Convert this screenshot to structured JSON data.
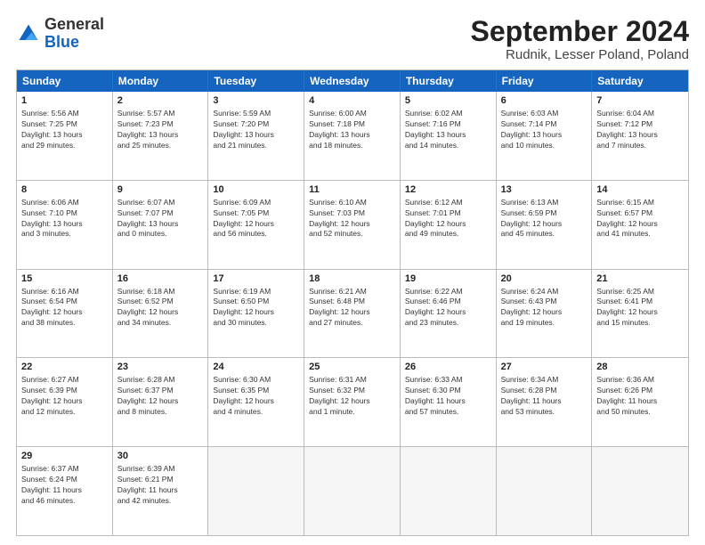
{
  "header": {
    "logo": {
      "general": "General",
      "blue": "Blue"
    },
    "month_title": "September 2024",
    "location": "Rudnik, Lesser Poland, Poland"
  },
  "weekdays": [
    "Sunday",
    "Monday",
    "Tuesday",
    "Wednesday",
    "Thursday",
    "Friday",
    "Saturday"
  ],
  "rows": [
    [
      {
        "day": "1",
        "info": "Sunrise: 5:56 AM\nSunset: 7:25 PM\nDaylight: 13 hours\nand 29 minutes."
      },
      {
        "day": "2",
        "info": "Sunrise: 5:57 AM\nSunset: 7:23 PM\nDaylight: 13 hours\nand 25 minutes."
      },
      {
        "day": "3",
        "info": "Sunrise: 5:59 AM\nSunset: 7:20 PM\nDaylight: 13 hours\nand 21 minutes."
      },
      {
        "day": "4",
        "info": "Sunrise: 6:00 AM\nSunset: 7:18 PM\nDaylight: 13 hours\nand 18 minutes."
      },
      {
        "day": "5",
        "info": "Sunrise: 6:02 AM\nSunset: 7:16 PM\nDaylight: 13 hours\nand 14 minutes."
      },
      {
        "day": "6",
        "info": "Sunrise: 6:03 AM\nSunset: 7:14 PM\nDaylight: 13 hours\nand 10 minutes."
      },
      {
        "day": "7",
        "info": "Sunrise: 6:04 AM\nSunset: 7:12 PM\nDaylight: 13 hours\nand 7 minutes."
      }
    ],
    [
      {
        "day": "8",
        "info": "Sunrise: 6:06 AM\nSunset: 7:10 PM\nDaylight: 13 hours\nand 3 minutes."
      },
      {
        "day": "9",
        "info": "Sunrise: 6:07 AM\nSunset: 7:07 PM\nDaylight: 13 hours\nand 0 minutes."
      },
      {
        "day": "10",
        "info": "Sunrise: 6:09 AM\nSunset: 7:05 PM\nDaylight: 12 hours\nand 56 minutes."
      },
      {
        "day": "11",
        "info": "Sunrise: 6:10 AM\nSunset: 7:03 PM\nDaylight: 12 hours\nand 52 minutes."
      },
      {
        "day": "12",
        "info": "Sunrise: 6:12 AM\nSunset: 7:01 PM\nDaylight: 12 hours\nand 49 minutes."
      },
      {
        "day": "13",
        "info": "Sunrise: 6:13 AM\nSunset: 6:59 PM\nDaylight: 12 hours\nand 45 minutes."
      },
      {
        "day": "14",
        "info": "Sunrise: 6:15 AM\nSunset: 6:57 PM\nDaylight: 12 hours\nand 41 minutes."
      }
    ],
    [
      {
        "day": "15",
        "info": "Sunrise: 6:16 AM\nSunset: 6:54 PM\nDaylight: 12 hours\nand 38 minutes."
      },
      {
        "day": "16",
        "info": "Sunrise: 6:18 AM\nSunset: 6:52 PM\nDaylight: 12 hours\nand 34 minutes."
      },
      {
        "day": "17",
        "info": "Sunrise: 6:19 AM\nSunset: 6:50 PM\nDaylight: 12 hours\nand 30 minutes."
      },
      {
        "day": "18",
        "info": "Sunrise: 6:21 AM\nSunset: 6:48 PM\nDaylight: 12 hours\nand 27 minutes."
      },
      {
        "day": "19",
        "info": "Sunrise: 6:22 AM\nSunset: 6:46 PM\nDaylight: 12 hours\nand 23 minutes."
      },
      {
        "day": "20",
        "info": "Sunrise: 6:24 AM\nSunset: 6:43 PM\nDaylight: 12 hours\nand 19 minutes."
      },
      {
        "day": "21",
        "info": "Sunrise: 6:25 AM\nSunset: 6:41 PM\nDaylight: 12 hours\nand 15 minutes."
      }
    ],
    [
      {
        "day": "22",
        "info": "Sunrise: 6:27 AM\nSunset: 6:39 PM\nDaylight: 12 hours\nand 12 minutes."
      },
      {
        "day": "23",
        "info": "Sunrise: 6:28 AM\nSunset: 6:37 PM\nDaylight: 12 hours\nand 8 minutes."
      },
      {
        "day": "24",
        "info": "Sunrise: 6:30 AM\nSunset: 6:35 PM\nDaylight: 12 hours\nand 4 minutes."
      },
      {
        "day": "25",
        "info": "Sunrise: 6:31 AM\nSunset: 6:32 PM\nDaylight: 12 hours\nand 1 minute."
      },
      {
        "day": "26",
        "info": "Sunrise: 6:33 AM\nSunset: 6:30 PM\nDaylight: 11 hours\nand 57 minutes."
      },
      {
        "day": "27",
        "info": "Sunrise: 6:34 AM\nSunset: 6:28 PM\nDaylight: 11 hours\nand 53 minutes."
      },
      {
        "day": "28",
        "info": "Sunrise: 6:36 AM\nSunset: 6:26 PM\nDaylight: 11 hours\nand 50 minutes."
      }
    ],
    [
      {
        "day": "29",
        "info": "Sunrise: 6:37 AM\nSunset: 6:24 PM\nDaylight: 11 hours\nand 46 minutes."
      },
      {
        "day": "30",
        "info": "Sunrise: 6:39 AM\nSunset: 6:21 PM\nDaylight: 11 hours\nand 42 minutes."
      },
      {
        "day": "",
        "info": ""
      },
      {
        "day": "",
        "info": ""
      },
      {
        "day": "",
        "info": ""
      },
      {
        "day": "",
        "info": ""
      },
      {
        "day": "",
        "info": ""
      }
    ]
  ]
}
